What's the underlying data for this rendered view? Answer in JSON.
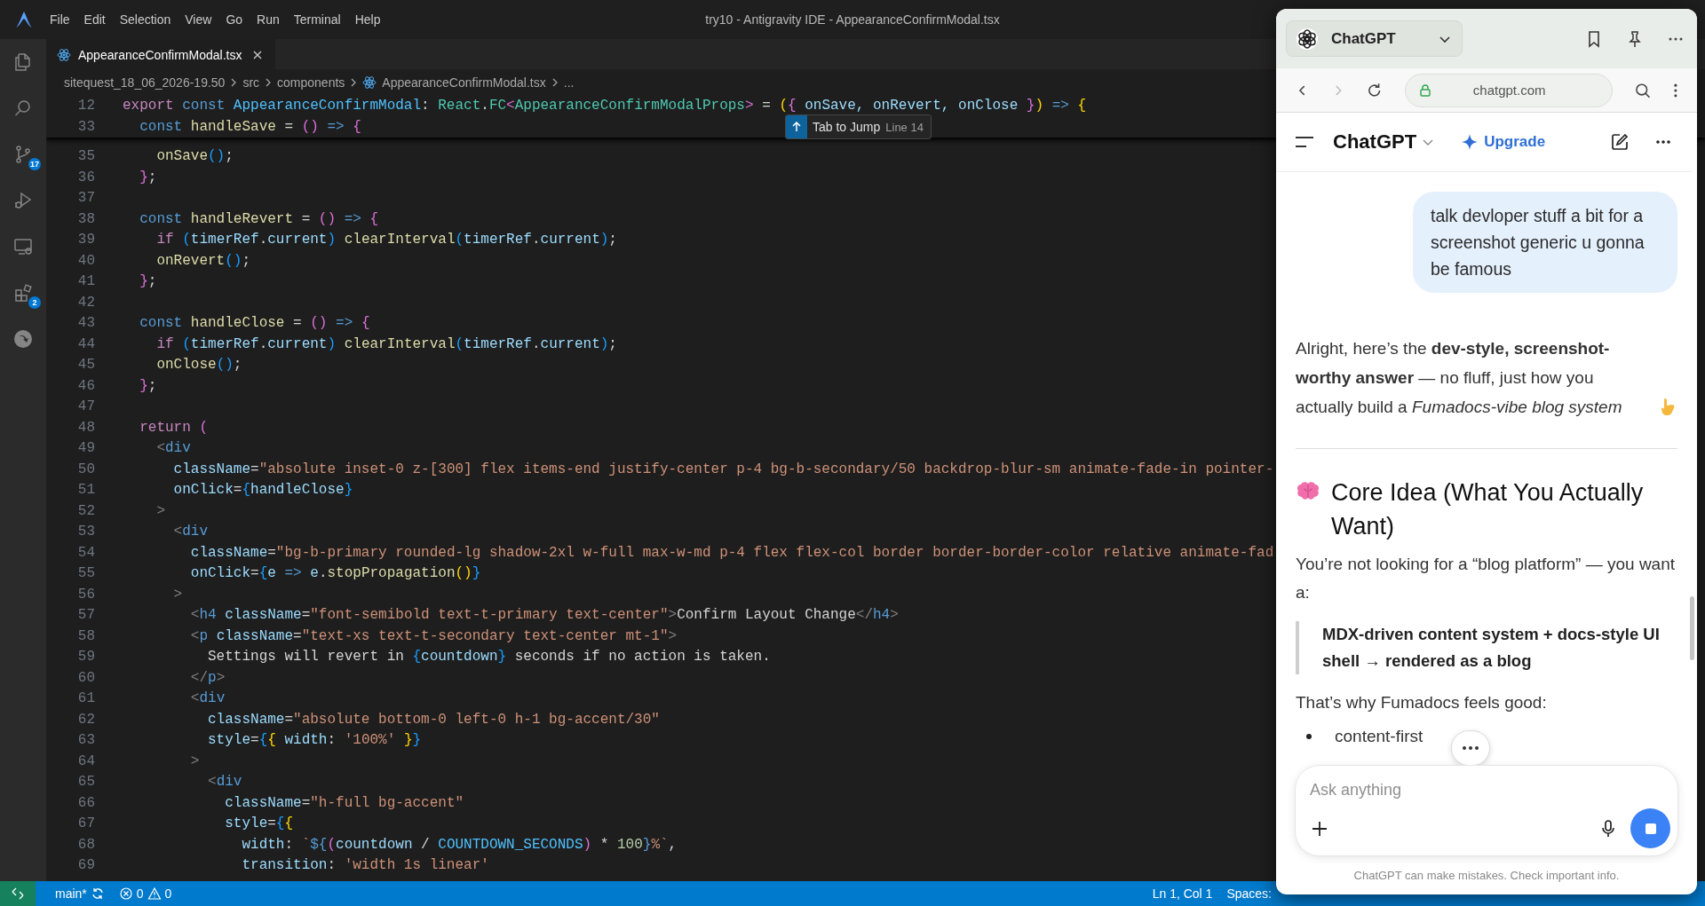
{
  "window": {
    "title": "try10 - Antigravity IDE - AppearanceConfirmModal.tsx"
  },
  "menu": [
    "File",
    "Edit",
    "Selection",
    "View",
    "Go",
    "Run",
    "Terminal",
    "Help"
  ],
  "activity_bar": [
    {
      "kind": "explorer"
    },
    {
      "kind": "search"
    },
    {
      "kind": "source-control",
      "badge": "17"
    },
    {
      "kind": "run"
    },
    {
      "kind": "remote"
    },
    {
      "kind": "extensions",
      "badge": "2"
    },
    {
      "kind": "agent"
    }
  ],
  "editor_tabs": [
    {
      "label": "AppearanceConfirmModal.tsx",
      "selected": true
    }
  ],
  "breadcrumbs": [
    {
      "label": "sitequest_18_06_2026-19.50",
      "kind": "folder"
    },
    {
      "label": "src",
      "kind": "folder"
    },
    {
      "label": "components",
      "kind": "folder"
    },
    {
      "label": "AppearanceConfirmModal.tsx",
      "kind": "file"
    },
    {
      "label": "...",
      "kind": "more"
    }
  ],
  "sticky_lines": [
    {
      "number": "12",
      "tokens": [
        {
          "text": "export ",
          "kind": "keyword"
        },
        {
          "text": "const ",
          "kind": "storage"
        },
        {
          "text": "AppearanceConfirmModal",
          "kind": "constant"
        },
        {
          "text": ": ",
          "kind": "plain"
        },
        {
          "text": "React",
          "kind": "type"
        },
        {
          "text": ".",
          "kind": "plain"
        },
        {
          "text": "FC",
          "kind": "type"
        },
        {
          "text": "<",
          "kind": "bracket2"
        },
        {
          "text": "AppearanceConfirmModalProps",
          "kind": "type"
        },
        {
          "text": ">",
          "kind": "bracket2"
        },
        {
          "text": " = ",
          "kind": "plain"
        },
        {
          "text": "(",
          "kind": "bracket1"
        },
        {
          "text": "{",
          "kind": "bracket2"
        },
        {
          "text": " onSave, onRevert, onClose ",
          "kind": "variable"
        },
        {
          "text": "}",
          "kind": "bracket2"
        },
        {
          "text": ") ",
          "kind": "bracket1"
        },
        {
          "text": "=> ",
          "kind": "storage"
        },
        {
          "text": "{",
          "kind": "bracket1"
        }
      ]
    },
    {
      "number": "33",
      "tokens": [
        {
          "text": "  const ",
          "kind": "storage"
        },
        {
          "text": "handleSave",
          "kind": "function"
        },
        {
          "text": " = ",
          "kind": "plain"
        },
        {
          "text": "() ",
          "kind": "bracket2"
        },
        {
          "text": "=> ",
          "kind": "storage"
        },
        {
          "text": "{",
          "kind": "bracket2"
        }
      ]
    }
  ],
  "code_lines": [
    {
      "number": "35",
      "tokens": [
        {
          "text": "    onSave",
          "kind": "function"
        },
        {
          "text": "()",
          "kind": "bracket3"
        },
        {
          "text": ";",
          "kind": "plain"
        }
      ]
    },
    {
      "number": "36",
      "tokens": [
        {
          "text": "  }",
          "kind": "bracket2"
        },
        {
          "text": ";",
          "kind": "plain"
        }
      ]
    },
    {
      "number": "37"
    },
    {
      "number": "38",
      "tokens": [
        {
          "text": "  const ",
          "kind": "storage"
        },
        {
          "text": "handleRevert",
          "kind": "function"
        },
        {
          "text": " = ",
          "kind": "plain"
        },
        {
          "text": "() ",
          "kind": "bracket2"
        },
        {
          "text": "=> ",
          "kind": "storage"
        },
        {
          "text": "{",
          "kind": "bracket2"
        }
      ]
    },
    {
      "number": "39",
      "tokens": [
        {
          "text": "    if ",
          "kind": "keyword"
        },
        {
          "text": "(",
          "kind": "bracket3"
        },
        {
          "text": "timerRef",
          "kind": "variable"
        },
        {
          "text": ".",
          "kind": "plain"
        },
        {
          "text": "current",
          "kind": "variable"
        },
        {
          "text": ") ",
          "kind": "bracket3"
        },
        {
          "text": "clearInterval",
          "kind": "function"
        },
        {
          "text": "(",
          "kind": "bracket3"
        },
        {
          "text": "timerRef",
          "kind": "variable"
        },
        {
          "text": ".",
          "kind": "plain"
        },
        {
          "text": "current",
          "kind": "variable"
        },
        {
          "text": ")",
          "kind": "bracket3"
        },
        {
          "text": ";",
          "kind": "plain"
        }
      ]
    },
    {
      "number": "40",
      "tokens": [
        {
          "text": "    onRevert",
          "kind": "function"
        },
        {
          "text": "()",
          "kind": "bracket3"
        },
        {
          "text": ";",
          "kind": "plain"
        }
      ]
    },
    {
      "number": "41",
      "tokens": [
        {
          "text": "  }",
          "kind": "bracket2"
        },
        {
          "text": ";",
          "kind": "plain"
        }
      ]
    },
    {
      "number": "42"
    },
    {
      "number": "43",
      "tokens": [
        {
          "text": "  const ",
          "kind": "storage"
        },
        {
          "text": "handleClose",
          "kind": "function"
        },
        {
          "text": " = ",
          "kind": "plain"
        },
        {
          "text": "() ",
          "kind": "bracket2"
        },
        {
          "text": "=> ",
          "kind": "storage"
        },
        {
          "text": "{",
          "kind": "bracket2"
        }
      ]
    },
    {
      "number": "44",
      "tokens": [
        {
          "text": "    if ",
          "kind": "keyword"
        },
        {
          "text": "(",
          "kind": "bracket3"
        },
        {
          "text": "timerRef",
          "kind": "variable"
        },
        {
          "text": ".",
          "kind": "plain"
        },
        {
          "text": "current",
          "kind": "variable"
        },
        {
          "text": ") ",
          "kind": "bracket3"
        },
        {
          "text": "clearInterval",
          "kind": "function"
        },
        {
          "text": "(",
          "kind": "bracket3"
        },
        {
          "text": "timerRef",
          "kind": "variable"
        },
        {
          "text": ".",
          "kind": "plain"
        },
        {
          "text": "current",
          "kind": "variable"
        },
        {
          "text": ")",
          "kind": "bracket3"
        },
        {
          "text": ";",
          "kind": "plain"
        }
      ]
    },
    {
      "number": "45",
      "tokens": [
        {
          "text": "    onClose",
          "kind": "function"
        },
        {
          "text": "()",
          "kind": "bracket3"
        },
        {
          "text": ";",
          "kind": "plain"
        }
      ]
    },
    {
      "number": "46",
      "tokens": [
        {
          "text": "  }",
          "kind": "bracket2"
        },
        {
          "text": ";",
          "kind": "plain"
        }
      ]
    },
    {
      "number": "47"
    },
    {
      "number": "48",
      "tokens": [
        {
          "text": "  return ",
          "kind": "keyword"
        },
        {
          "text": "(",
          "kind": "bracket2"
        }
      ]
    },
    {
      "number": "49",
      "tokens": [
        {
          "text": "    <",
          "kind": "punct"
        },
        {
          "text": "div",
          "kind": "tag"
        }
      ]
    },
    {
      "number": "50",
      "tokens": [
        {
          "text": "      className",
          "kind": "attribute"
        },
        {
          "text": "=",
          "kind": "plain"
        },
        {
          "text": "\"absolute inset-0 z-[300] flex items-end justify-center p-4 bg-b-secondary/50 backdrop-blur-sm animate-fade-in pointer-",
          "kind": "string"
        }
      ]
    },
    {
      "number": "51",
      "tokens": [
        {
          "text": "      onClick",
          "kind": "attribute"
        },
        {
          "text": "=",
          "kind": "plain"
        },
        {
          "text": "{",
          "kind": "bracket3"
        },
        {
          "text": "handleClose",
          "kind": "variable"
        },
        {
          "text": "}",
          "kind": "bracket3"
        }
      ]
    },
    {
      "number": "52",
      "tokens": [
        {
          "text": "    >",
          "kind": "punct"
        }
      ]
    },
    {
      "number": "53",
      "tokens": [
        {
          "text": "      <",
          "kind": "punct"
        },
        {
          "text": "div",
          "kind": "tag"
        }
      ]
    },
    {
      "number": "54",
      "tokens": [
        {
          "text": "        className",
          "kind": "attribute"
        },
        {
          "text": "=",
          "kind": "plain"
        },
        {
          "text": "\"bg-b-primary rounded-lg shadow-2xl w-full max-w-md p-4 flex flex-col border border-border-color relative animate-fad",
          "kind": "string"
        }
      ]
    },
    {
      "number": "55",
      "tokens": [
        {
          "text": "        onClick",
          "kind": "attribute"
        },
        {
          "text": "=",
          "kind": "plain"
        },
        {
          "text": "{",
          "kind": "bracket3"
        },
        {
          "text": "e ",
          "kind": "variable"
        },
        {
          "text": "=> ",
          "kind": "storage"
        },
        {
          "text": "e",
          "kind": "variable"
        },
        {
          "text": ".",
          "kind": "plain"
        },
        {
          "text": "stopPropagation",
          "kind": "function"
        },
        {
          "text": "()",
          "kind": "bracket1"
        },
        {
          "text": "}",
          "kind": "bracket3"
        }
      ]
    },
    {
      "number": "56",
      "tokens": [
        {
          "text": "      >",
          "kind": "punct"
        }
      ]
    },
    {
      "number": "57",
      "tokens": [
        {
          "text": "        <",
          "kind": "punct"
        },
        {
          "text": "h4 ",
          "kind": "tag"
        },
        {
          "text": "className",
          "kind": "attribute"
        },
        {
          "text": "=",
          "kind": "plain"
        },
        {
          "text": "\"font-semibold text-t-primary text-center\"",
          "kind": "string"
        },
        {
          "text": ">",
          "kind": "punct"
        },
        {
          "text": "Confirm Layout Change",
          "kind": "plain"
        },
        {
          "text": "</",
          "kind": "punct"
        },
        {
          "text": "h4",
          "kind": "tag"
        },
        {
          "text": ">",
          "kind": "punct"
        }
      ]
    },
    {
      "number": "58",
      "tokens": [
        {
          "text": "        <",
          "kind": "punct"
        },
        {
          "text": "p ",
          "kind": "tag"
        },
        {
          "text": "className",
          "kind": "attribute"
        },
        {
          "text": "=",
          "kind": "plain"
        },
        {
          "text": "\"text-xs text-t-secondary text-center mt-1\"",
          "kind": "string"
        },
        {
          "text": ">",
          "kind": "punct"
        }
      ]
    },
    {
      "number": "59",
      "tokens": [
        {
          "text": "          Settings will revert in ",
          "kind": "plain"
        },
        {
          "text": "{",
          "kind": "bracket3"
        },
        {
          "text": "countdown",
          "kind": "variable"
        },
        {
          "text": "}",
          "kind": "bracket3"
        },
        {
          "text": " seconds if no action is taken.",
          "kind": "plain"
        }
      ]
    },
    {
      "number": "60",
      "tokens": [
        {
          "text": "        </",
          "kind": "punct"
        },
        {
          "text": "p",
          "kind": "tag"
        },
        {
          "text": ">",
          "kind": "punct"
        }
      ]
    },
    {
      "number": "61",
      "tokens": [
        {
          "text": "        <",
          "kind": "punct"
        },
        {
          "text": "div",
          "kind": "tag"
        }
      ]
    },
    {
      "number": "62",
      "tokens": [
        {
          "text": "          className",
          "kind": "attribute"
        },
        {
          "text": "=",
          "kind": "plain"
        },
        {
          "text": "\"absolute bottom-0 left-0 h-1 bg-accent/30\"",
          "kind": "string"
        }
      ]
    },
    {
      "number": "63",
      "tokens": [
        {
          "text": "          style",
          "kind": "attribute"
        },
        {
          "text": "=",
          "kind": "plain"
        },
        {
          "text": "{",
          "kind": "bracket3"
        },
        {
          "text": "{ ",
          "kind": "bracket1"
        },
        {
          "text": "width",
          "kind": "variable"
        },
        {
          "text": ": ",
          "kind": "plain"
        },
        {
          "text": "'100%' ",
          "kind": "string"
        },
        {
          "text": "}",
          "kind": "bracket1"
        },
        {
          "text": "}",
          "kind": "bracket3"
        }
      ]
    },
    {
      "number": "64",
      "tokens": [
        {
          "text": "        >",
          "kind": "punct"
        }
      ]
    },
    {
      "number": "65",
      "tokens": [
        {
          "text": "          <",
          "kind": "punct"
        },
        {
          "text": "div",
          "kind": "tag"
        }
      ]
    },
    {
      "number": "66",
      "tokens": [
        {
          "text": "            className",
          "kind": "attribute"
        },
        {
          "text": "=",
          "kind": "plain"
        },
        {
          "text": "\"h-full bg-accent\"",
          "kind": "string"
        }
      ]
    },
    {
      "number": "67",
      "tokens": [
        {
          "text": "            style",
          "kind": "attribute"
        },
        {
          "text": "=",
          "kind": "plain"
        },
        {
          "text": "{",
          "kind": "bracket3"
        },
        {
          "text": "{",
          "kind": "bracket1"
        }
      ]
    },
    {
      "number": "68",
      "tokens": [
        {
          "text": "              width",
          "kind": "variable"
        },
        {
          "text": ": ",
          "kind": "plain"
        },
        {
          "text": "`",
          "kind": "string"
        },
        {
          "text": "${",
          "kind": "storage"
        },
        {
          "text": "(",
          "kind": "bracket2"
        },
        {
          "text": "countdown",
          "kind": "variable"
        },
        {
          "text": " / ",
          "kind": "plain"
        },
        {
          "text": "COUNTDOWN_SECONDS",
          "kind": "constant"
        },
        {
          "text": ")",
          "kind": "bracket2"
        },
        {
          "text": " * ",
          "kind": "plain"
        },
        {
          "text": "100",
          "kind": "number"
        },
        {
          "text": "}",
          "kind": "storage"
        },
        {
          "text": "%`",
          "kind": "string"
        },
        {
          "text": ",",
          "kind": "plain"
        }
      ]
    },
    {
      "number": "69",
      "tokens": [
        {
          "text": "              transition",
          "kind": "variable"
        },
        {
          "text": ": ",
          "kind": "plain"
        },
        {
          "text": "'width 1s linear'",
          "kind": "string"
        }
      ]
    }
  ],
  "jump_hint": {
    "label": "Tab to Jump",
    "detail": "Line 14"
  },
  "status_bar": {
    "branch": "main*",
    "errors": "0",
    "warnings": "0",
    "position": "Ln 1, Col 1",
    "indent": "Spaces:"
  },
  "browser": {
    "tab_title": "ChatGPT",
    "url": "chatgpt.com",
    "forward_disabled": true,
    "page": {
      "title": "ChatGPT",
      "upgrade": "Upgrade",
      "items": [
        {
          "kind": "user",
          "text": "talk devloper stuff a bit for a screenshot generic u gonna be famous"
        },
        {
          "kind": "lead",
          "text": "Alright, here’s the **dev-style, screenshot-worthy answer** — no fluff, just how you actually build a *Fumadocs-vibe blog system*"
        },
        {
          "kind": "divider"
        },
        {
          "kind": "heading",
          "text": "Core Idea (What You Actually Want)"
        },
        {
          "kind": "paragraph",
          "text": "You’re not looking for a “blog platform” — you want a:"
        },
        {
          "kind": "quote",
          "text": "**MDX-driven content system + docs-style UI shell → rendered as a blog**"
        },
        {
          "kind": "paragraph",
          "text": "That’s why Fumadocs feels good:"
        },
        {
          "kind": "bullet",
          "text": "content-first"
        }
      ],
      "composer": {
        "placeholder": "Ask anything"
      },
      "disclaimer": "ChatGPT can make mistakes. Check important info."
    }
  }
}
